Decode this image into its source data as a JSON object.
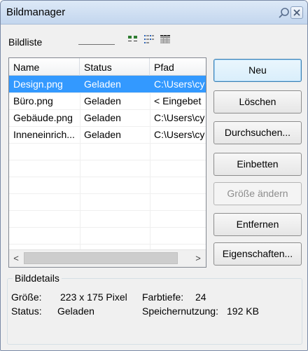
{
  "window": {
    "title": "Bildmanager"
  },
  "image_list": {
    "label": "Bildliste",
    "columns": [
      "Name",
      "Status",
      "Pfad"
    ],
    "rows": [
      {
        "name": "Design.png",
        "status": "Geladen",
        "path": "C:\\Users\\cy",
        "selected": true
      },
      {
        "name": "Büro.png",
        "status": "Geladen",
        "path": "< Eingebet",
        "selected": false
      },
      {
        "name": "Gebäude.png",
        "status": "Geladen",
        "path": "C:\\Users\\cy",
        "selected": false
      },
      {
        "name": "Inneneinrich...",
        "status": "Geladen",
        "path": "C:\\Users\\cy",
        "selected": false
      }
    ],
    "scroll_left_glyph": "<",
    "scroll_right_glyph": ">"
  },
  "buttons": {
    "new": "Neu",
    "delete": "Löschen",
    "browse": "Durchsuchen...",
    "embed": "Einbetten",
    "resize": "Größe ändern",
    "remove": "Entfernen",
    "properties": "Eigenschaften..."
  },
  "details": {
    "title": "Bilddetails",
    "size_label": "Größe:",
    "size_value": "223 x 175 Pixel",
    "depth_label": "Farbtiefe:",
    "depth_value": "24",
    "status_label": "Status:",
    "status_value": "Geladen",
    "memory_label": "Speichernutzung:",
    "memory_value": "192 KB"
  },
  "icons": {
    "pin": "pin-icon",
    "close": "close-icon",
    "view_large": "large-icons-view-icon",
    "view_list": "list-view-icon",
    "view_details": "details-view-icon"
  },
  "colors": {
    "selection": "#3399ff",
    "title_bar": "#c3d6ee",
    "disabled_text": "#8d8d8d"
  }
}
